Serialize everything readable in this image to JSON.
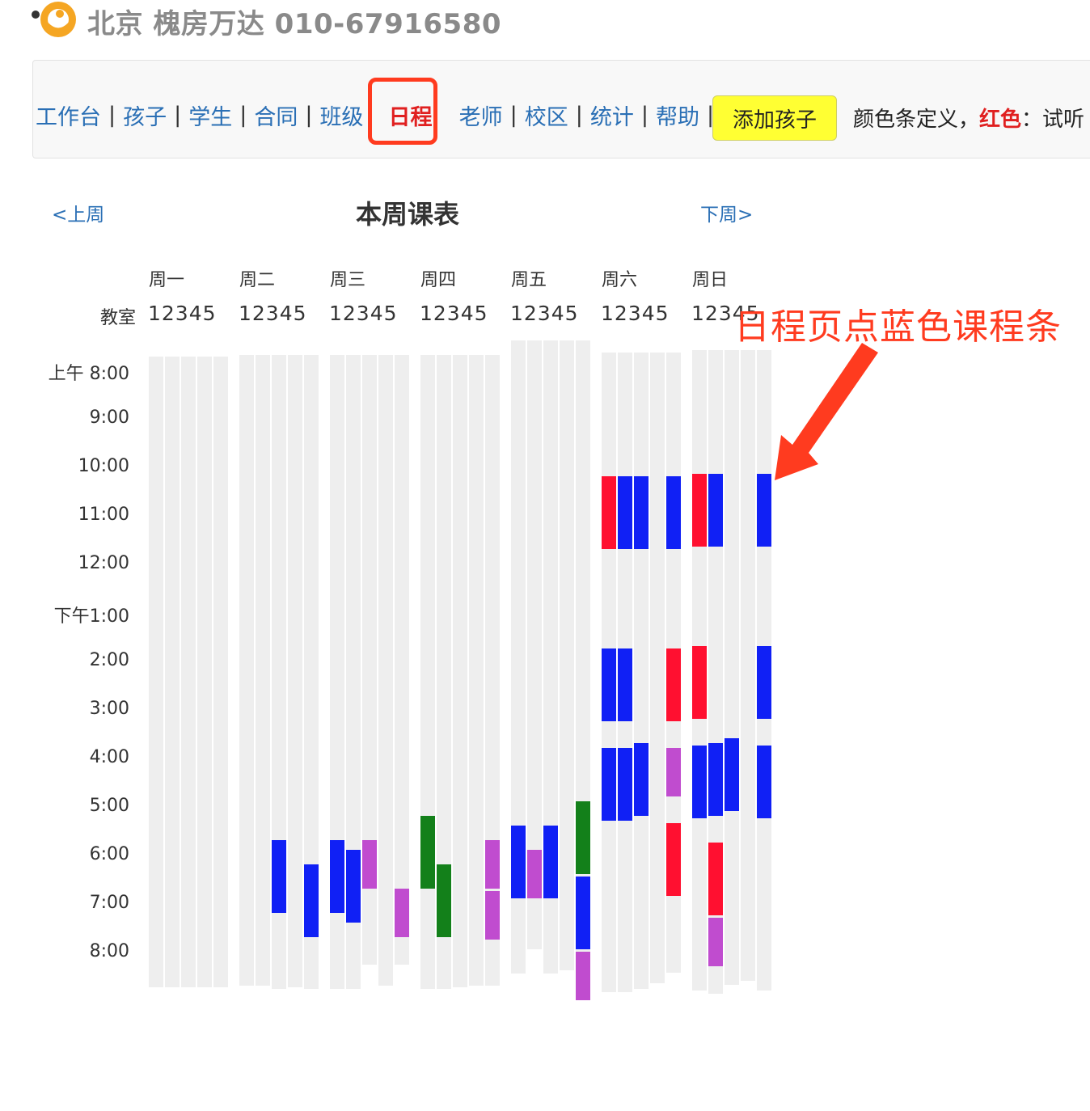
{
  "header": {
    "title": "北京 槐房万达 010-67916580"
  },
  "nav": {
    "items": [
      {
        "label": "工作台",
        "name": "nav-workbench"
      },
      {
        "label": "孩子",
        "name": "nav-children"
      },
      {
        "label": "学生",
        "name": "nav-students"
      },
      {
        "label": "合同",
        "name": "nav-contracts"
      },
      {
        "label": "班级",
        "name": "nav-classes"
      },
      {
        "label": "日程",
        "name": "nav-schedule",
        "active": true
      },
      {
        "label": "老师",
        "name": "nav-teachers"
      },
      {
        "label": "校区",
        "name": "nav-campus"
      },
      {
        "label": "统计",
        "name": "nav-statistics"
      },
      {
        "label": "帮助",
        "name": "nav-help"
      }
    ],
    "add_child_label": "添加孩子",
    "legend_prefix": "颜色条定义，",
    "legend_red": "红色",
    "legend_suffix": "：试听"
  },
  "schedule": {
    "title": "本周课表",
    "prev_week": "<上周",
    "next_week": "下周>",
    "room_label": "教室",
    "room_numbers": "12345",
    "days": [
      "周一",
      "周二",
      "周三",
      "周四",
      "周五",
      "周六",
      "周日"
    ],
    "time_labels": [
      "上午 8:00",
      "9:00",
      "10:00",
      "11:00",
      "12:00",
      "下午1:00",
      "2:00",
      "3:00",
      "4:00",
      "5:00",
      "6:00",
      "7:00",
      "8:00"
    ]
  },
  "colors": {
    "blue": "#1020f5",
    "red": "#ff1030",
    "purple": "#c04ccf",
    "green": "#13801a",
    "track": "#eeeeee",
    "highlight": "#ff3b1f"
  },
  "chart_data": {
    "type": "table",
    "legend": "颜色条定义，红色：试听",
    "sessions": [
      {
        "day": "周二",
        "room": 3,
        "start": 17.7,
        "end": 19.2,
        "color": "blue"
      },
      {
        "day": "周二",
        "room": 5,
        "start": 18.2,
        "end": 19.7,
        "color": "blue"
      },
      {
        "day": "周三",
        "room": 1,
        "start": 17.7,
        "end": 19.2,
        "color": "blue"
      },
      {
        "day": "周三",
        "room": 2,
        "start": 17.9,
        "end": 19.4,
        "color": "blue"
      },
      {
        "day": "周三",
        "room": 3,
        "start": 17.7,
        "end": 18.7,
        "color": "purple"
      },
      {
        "day": "周三",
        "room": 5,
        "start": 18.7,
        "end": 19.7,
        "color": "purple"
      },
      {
        "day": "周四",
        "room": 1,
        "start": 17.2,
        "end": 18.7,
        "color": "green"
      },
      {
        "day": "周四",
        "room": 2,
        "start": 18.2,
        "end": 19.7,
        "color": "green"
      },
      {
        "day": "周四",
        "room": 5,
        "start": 17.7,
        "end": 18.7,
        "color": "purple"
      },
      {
        "day": "周四",
        "room": 5,
        "start": 18.75,
        "end": 19.75,
        "color": "purple"
      },
      {
        "day": "周五",
        "room": 1,
        "start": 17.4,
        "end": 18.9,
        "color": "blue"
      },
      {
        "day": "周五",
        "room": 2,
        "start": 17.9,
        "end": 18.9,
        "color": "purple"
      },
      {
        "day": "周五",
        "room": 3,
        "start": 17.4,
        "end": 18.9,
        "color": "blue"
      },
      {
        "day": "周五",
        "room": 5,
        "start": 16.9,
        "end": 18.4,
        "color": "green"
      },
      {
        "day": "周五",
        "room": 5,
        "start": 18.45,
        "end": 19.95,
        "color": "blue"
      },
      {
        "day": "周五",
        "room": 5,
        "start": 20.0,
        "end": 21.0,
        "color": "purple"
      },
      {
        "day": "周六",
        "room": 1,
        "start": 10.2,
        "end": 11.7,
        "color": "red"
      },
      {
        "day": "周六",
        "room": 2,
        "start": 10.2,
        "end": 11.7,
        "color": "blue"
      },
      {
        "day": "周六",
        "room": 3,
        "start": 10.2,
        "end": 11.7,
        "color": "blue"
      },
      {
        "day": "周六",
        "room": 5,
        "start": 10.2,
        "end": 11.7,
        "color": "blue"
      },
      {
        "day": "周六",
        "room": 1,
        "start": 13.75,
        "end": 15.25,
        "color": "blue"
      },
      {
        "day": "周六",
        "room": 2,
        "start": 13.75,
        "end": 15.25,
        "color": "blue"
      },
      {
        "day": "周六",
        "room": 5,
        "start": 13.75,
        "end": 15.25,
        "color": "red"
      },
      {
        "day": "周六",
        "room": 1,
        "start": 15.8,
        "end": 17.3,
        "color": "blue"
      },
      {
        "day": "周六",
        "room": 2,
        "start": 15.8,
        "end": 17.3,
        "color": "blue"
      },
      {
        "day": "周六",
        "room": 3,
        "start": 15.7,
        "end": 17.2,
        "color": "blue"
      },
      {
        "day": "周六",
        "room": 5,
        "start": 15.8,
        "end": 16.8,
        "color": "purple"
      },
      {
        "day": "周六",
        "room": 5,
        "start": 17.35,
        "end": 18.85,
        "color": "red"
      },
      {
        "day": "周日",
        "room": 1,
        "start": 10.15,
        "end": 11.65,
        "color": "red"
      },
      {
        "day": "周日",
        "room": 2,
        "start": 10.15,
        "end": 11.65,
        "color": "blue"
      },
      {
        "day": "周日",
        "room": 5,
        "start": 10.15,
        "end": 11.65,
        "color": "blue"
      },
      {
        "day": "周日",
        "room": 1,
        "start": 13.7,
        "end": 15.2,
        "color": "red"
      },
      {
        "day": "周日",
        "room": 5,
        "start": 13.7,
        "end": 15.2,
        "color": "blue"
      },
      {
        "day": "周日",
        "room": 1,
        "start": 15.75,
        "end": 17.25,
        "color": "blue"
      },
      {
        "day": "周日",
        "room": 2,
        "start": 15.7,
        "end": 17.2,
        "color": "blue"
      },
      {
        "day": "周日",
        "room": 3,
        "start": 15.6,
        "end": 17.1,
        "color": "blue"
      },
      {
        "day": "周日",
        "room": 5,
        "start": 15.75,
        "end": 17.25,
        "color": "blue"
      },
      {
        "day": "周日",
        "room": 2,
        "start": 17.75,
        "end": 19.25,
        "color": "red"
      },
      {
        "day": "周日",
        "room": 2,
        "start": 19.3,
        "end": 20.3,
        "color": "purple"
      }
    ]
  },
  "annotation": {
    "text": "日程页点蓝色课程条"
  }
}
